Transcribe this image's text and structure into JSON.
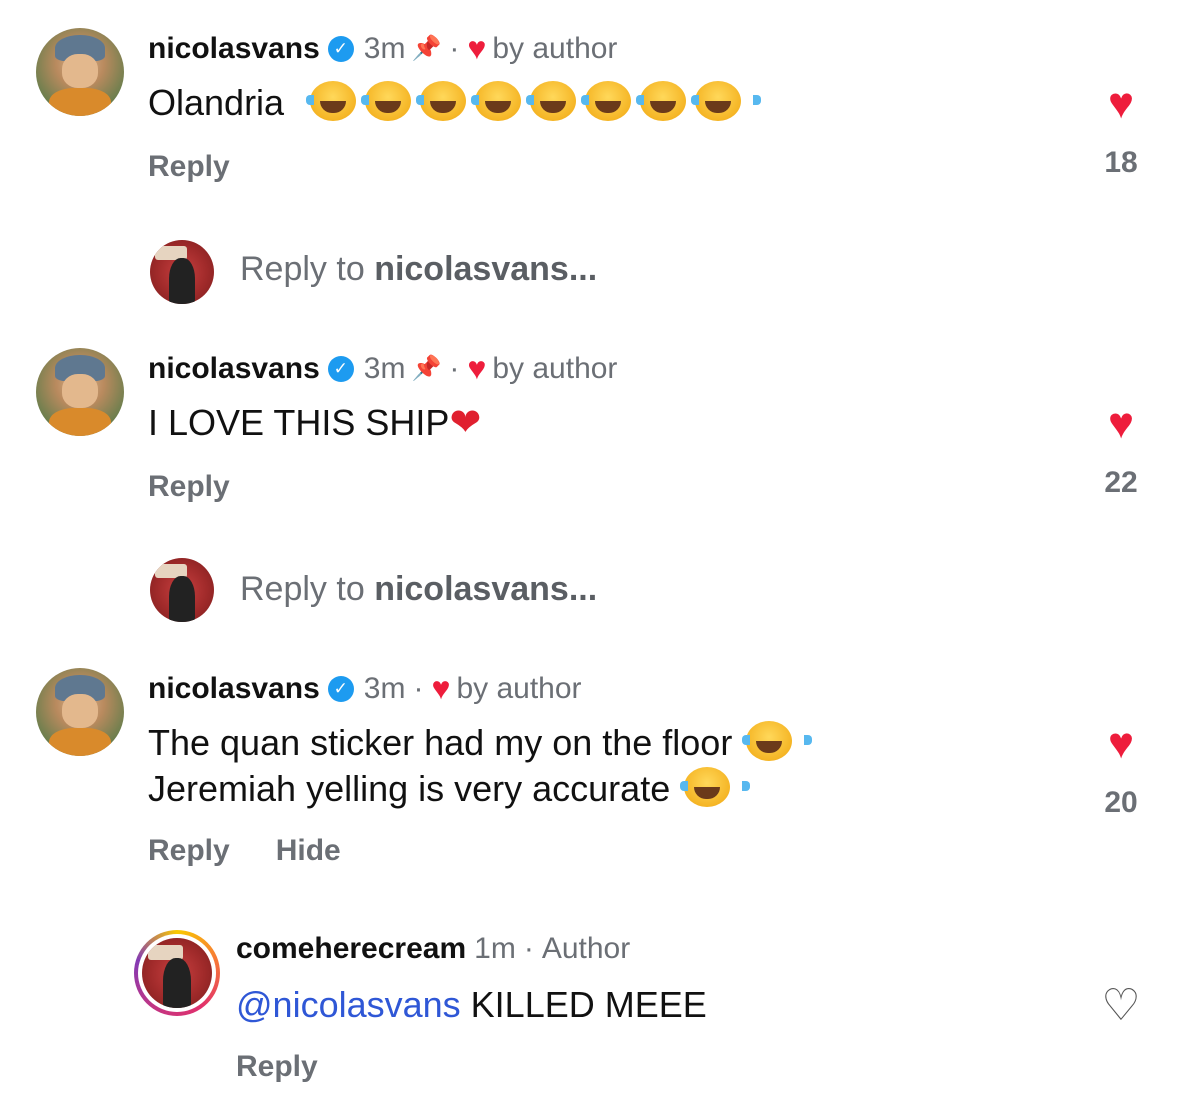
{
  "comments": [
    {
      "username": "nicolasvans",
      "time": "3m",
      "liked_by": "by author",
      "text": "Olandria",
      "reply": "Reply",
      "likes": "18",
      "reply_prompt_prefix": "Reply to ",
      "reply_prompt_user": "nicolasvans..."
    },
    {
      "username": "nicolasvans",
      "time": "3m",
      "liked_by": "by author",
      "text": "I LOVE THIS SHIP",
      "reply": "Reply",
      "likes": "22",
      "reply_prompt_prefix": "Reply to ",
      "reply_prompt_user": "nicolasvans..."
    },
    {
      "username": "nicolasvans",
      "time": "3m",
      "liked_by": "by author",
      "text_line1": "The quan sticker had my on the floor",
      "text_line2": "Jeremiah yelling is very accurate",
      "reply": "Reply",
      "hide": "Hide",
      "likes": "20"
    },
    {
      "username": "comeherecream",
      "time": "1m",
      "role": "Author",
      "mention": "@nicolasvans",
      "text": " KILLED MEEE",
      "reply": "Reply"
    }
  ],
  "icons": {
    "verified": "verified-badge-icon",
    "pin": "pin-icon",
    "heart": "heart-icon",
    "laugh": "face-with-tears-of-joy-emoji",
    "heart_outline": "heart-outline-icon"
  },
  "glyphs": {
    "check": "✓",
    "pin": "📌",
    "dot": "·",
    "heart": "♥",
    "heart_outline": "♡",
    "heart_emoji": "❤"
  },
  "colors": {
    "like_red": "#ee1d3c",
    "verified_blue": "#1d9bf0",
    "mention_blue": "#2f57d6",
    "muted_gray": "#6b6f75"
  }
}
